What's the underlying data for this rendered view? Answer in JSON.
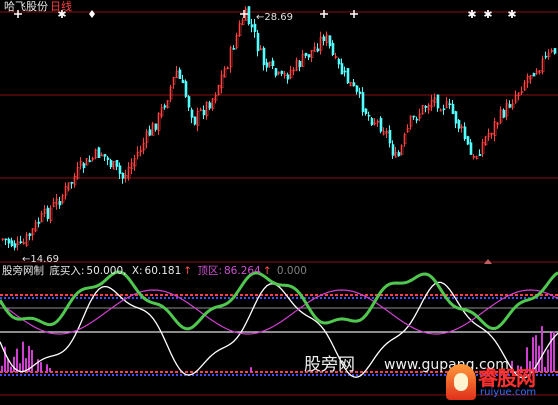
{
  "title": {
    "stock": "哈飞股份",
    "period": "日线"
  },
  "price_labels": {
    "high": "28.69",
    "low": "14.69"
  },
  "indicator": {
    "name": "股旁网制",
    "buy_label": "底买入:",
    "buy_value": "50.000,",
    "x_label": "X:",
    "x_value": "60.181",
    "top_label": "顶区:",
    "top_value": "86.264",
    "zero_value": "0.000",
    "arrow": "↑"
  },
  "watermark": {
    "cn": "股旁网",
    "url": "www.gupang.com"
  },
  "logo": {
    "cn": "睿股网",
    "en": "ruiyue.com"
  },
  "colors": {
    "up": "#ff4040",
    "down": "#54ffff",
    "magenta": "#d040d0",
    "green": "#50c850",
    "blue": "#4050ff",
    "white": "#ffffff",
    "grid": "#8a1010"
  },
  "chart_data": {
    "type": "candlestick",
    "price_high": 28.69,
    "price_low": 14.69,
    "signal_markers": [
      "cross",
      "star",
      "diamond",
      "cross",
      "cross",
      "star",
      "star",
      "star"
    ],
    "indicator_levels": {
      "buy": 50.0,
      "x": 60.181,
      "top": 86.264,
      "zero": 0.0
    }
  }
}
